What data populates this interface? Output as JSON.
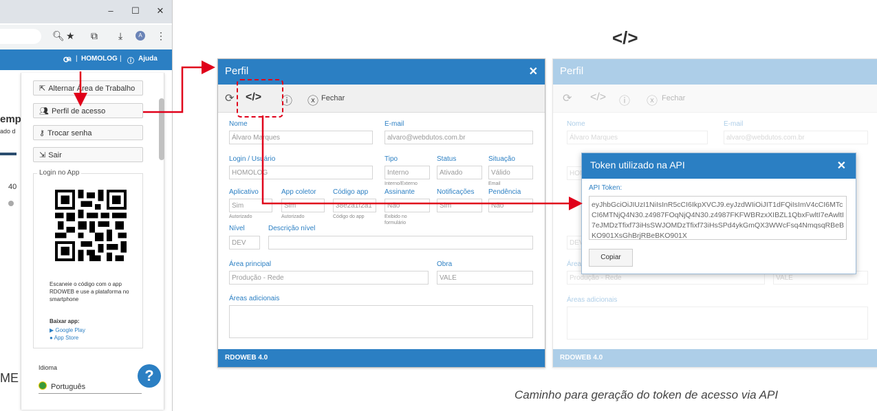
{
  "browser": {
    "window_controls": [
      "–",
      "☐",
      "✕"
    ],
    "app_bar": {
      "user": "HOMOLOG",
      "help": "Ajuda"
    },
    "menu": {
      "items": [
        "Alternar Área de Trabalho",
        "Perfil de acesso",
        "Trocar senha",
        "Sair"
      ],
      "login_title": "Login no App",
      "scan_text": "Escaneie o código com o app RDOWEB e use a plataforma no smartphone",
      "download_title": "Baixar app:",
      "google_play": "Google Play",
      "app_store": "App Store",
      "language_label": "Idioma",
      "language_value": "Português"
    },
    "bg_fragments": [
      "emp",
      "ado d",
      "40",
      "ME"
    ]
  },
  "profile": {
    "title": "Perfil",
    "close": "✕",
    "toolbar": {
      "close_label": "Fechar"
    },
    "fields": {
      "nome_label": "Nome",
      "nome_value": "Álvaro Marques",
      "email_label": "E-mail",
      "email_value": "alvaro@webdutos.com.br",
      "login_label": "Login / Usuário",
      "login_value": "HOMOLOG",
      "tipo_label": "Tipo",
      "tipo_value": "Interno",
      "tipo_hint": "Interno/Externo",
      "status_label": "Status",
      "status_value": "Ativado",
      "situacao_label": "Situação",
      "situacao_value": "Válido",
      "situacao_hint": "Email",
      "aplicativo_label": "Aplicativo",
      "aplicativo_value": "Sim",
      "aplicativo_hint": "Autorizado",
      "coletor_label": "App coletor",
      "coletor_value": "Sim",
      "coletor_hint": "Autorizado",
      "codigo_label": "Código app",
      "codigo_value": "38e2a1f2a1",
      "codigo_hint": "Código do app",
      "assinante_label": "Assinante",
      "assinante_value": "Não",
      "assinante_hint": "Exibido no formulário",
      "notif_label": "Notificações",
      "notif_value": "Sim",
      "pendencia_label": "Pendência",
      "pendencia_value": "Não",
      "nivel_label": "Nível",
      "nivel_value": "DEV",
      "descnivel_label": "Descrição nível",
      "descnivel_value": "",
      "area_label": "Área principal",
      "area_value": "Produção - Rede",
      "obra_label": "Obra",
      "obra_value": "VALE",
      "areas_add_label": "Áreas adicionais"
    },
    "footer": "RDOWEB 4.0"
  },
  "right_icon": "</>",
  "token_dialog": {
    "title": "Token utilizado na API",
    "close": "✕",
    "label": "API Token:",
    "token": "eyJhbGciOiJIUzI1NiIsInR5cCI6IkpXVCJ9.eyJzdWIiOiJIT1dFQiIsImV4cCI6MTcCI6MTNjQ4N30.z4987FOqNjQ4N30.z4987FKFWBRzxXIBZL1QbxFwltI7eAwltI7eJMDzTfixf73iHsSWJOMDzTfixf73iHsSPd4ykGmQX3WWcFsq4NmqsqRBeBKO901XsGhBrjRBeBKO901X",
    "copy": "Copiar"
  },
  "caption": "Caminho para geração do token de acesso via API",
  "colors": {
    "primary": "#2b7fc3",
    "annotation": "#e0001a"
  }
}
